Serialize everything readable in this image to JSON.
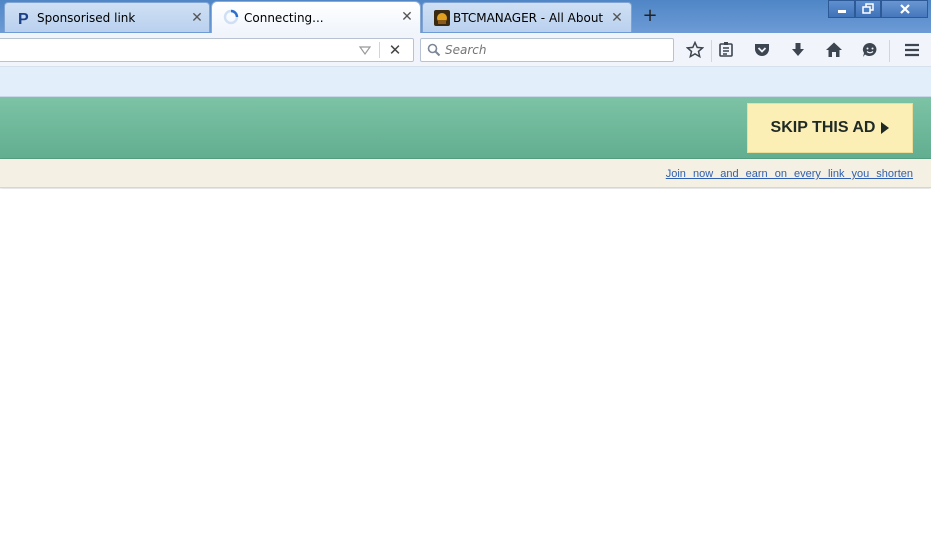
{
  "tabs": [
    {
      "title": "Sponsorised link",
      "icon": "p-logo-icon",
      "active": false
    },
    {
      "title": "Connecting...",
      "icon": "loading-spinner-icon",
      "active": true
    },
    {
      "title": "BTCMANAGER - All About ...",
      "icon": "btcmanager-favicon-icon",
      "active": false
    }
  ],
  "search": {
    "placeholder": "Search"
  },
  "ad": {
    "skip_label": "SKIP THIS AD"
  },
  "promo": {
    "link_text": "Join now and earn on every link you shorten"
  },
  "colors": {
    "tabbar": "#5a8fcf",
    "ad_bar": "#6fb99b",
    "skip_button": "#fbefb6",
    "promo_bar": "#f4f0e4",
    "link": "#2f5fb0"
  }
}
